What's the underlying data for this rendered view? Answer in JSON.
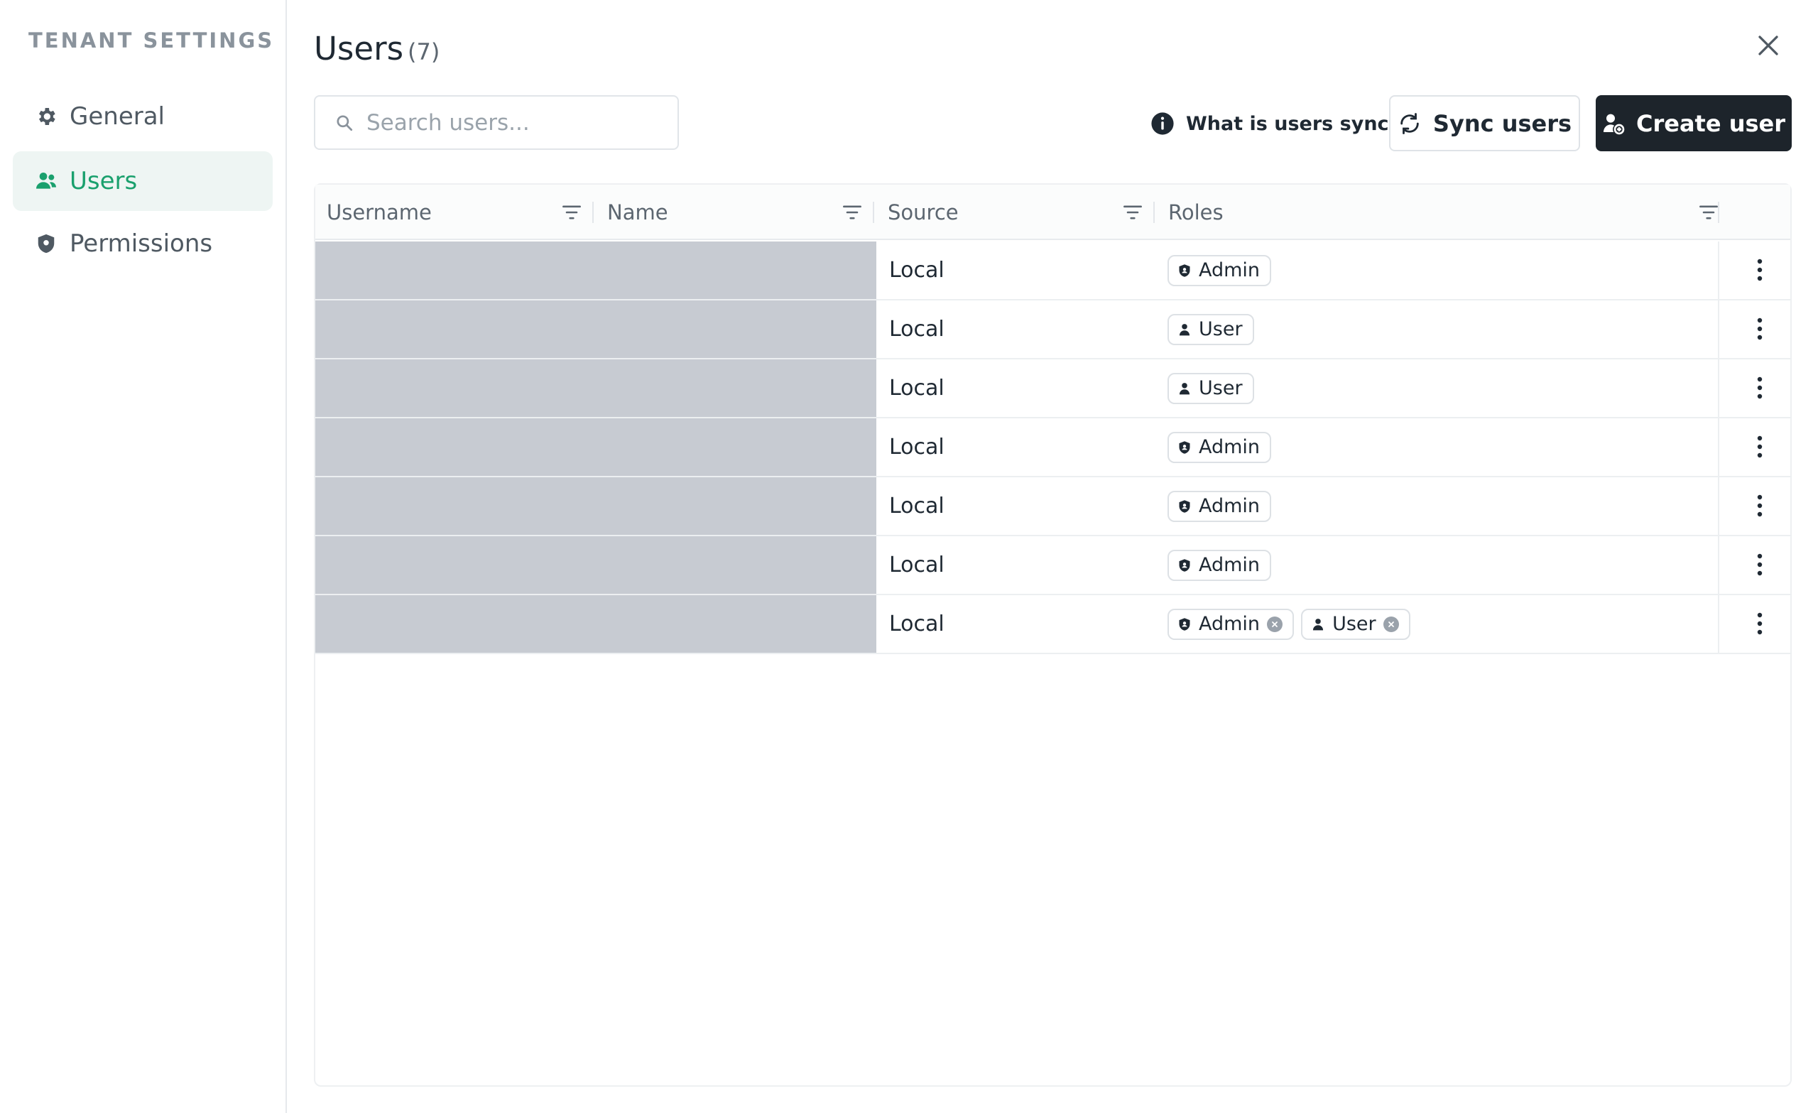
{
  "sidebar": {
    "heading": "TENANT SETTINGS",
    "items": [
      {
        "label": "General",
        "icon": "gear-icon",
        "active": false
      },
      {
        "label": "Users",
        "icon": "users-icon",
        "active": true
      },
      {
        "label": "Permissions",
        "icon": "shield-icon",
        "active": false
      }
    ]
  },
  "header": {
    "title": "Users",
    "count": "(7)"
  },
  "toolbar": {
    "search_placeholder": "Search users...",
    "search_value": "",
    "help_label": "What is users sync?",
    "sync_label": "Sync users",
    "create_label": "Create user"
  },
  "table": {
    "columns": [
      "Username",
      "Name",
      "Source",
      "Roles"
    ],
    "rows": [
      {
        "username": "",
        "name": "",
        "source": "Local",
        "roles": [
          "Admin"
        ]
      },
      {
        "username": "",
        "name": "",
        "source": "Local",
        "roles": [
          "User"
        ]
      },
      {
        "username": "",
        "name": "",
        "source": "Local",
        "roles": [
          "User"
        ]
      },
      {
        "username": "",
        "name": "",
        "source": "Local",
        "roles": [
          "Admin"
        ]
      },
      {
        "username": "",
        "name": "",
        "source": "Local",
        "roles": [
          "Admin"
        ]
      },
      {
        "username": "",
        "name": "",
        "source": "Local",
        "roles": [
          "Admin"
        ]
      },
      {
        "username": "",
        "name": "",
        "source": "Local",
        "roles": [
          "Admin",
          "User"
        ],
        "removable": true
      }
    ]
  },
  "colors": {
    "accent": "#1aa06d",
    "accent_bg": "#eef5f3",
    "primary_button": "#1d242b",
    "redacted": "#c7cbd2"
  }
}
